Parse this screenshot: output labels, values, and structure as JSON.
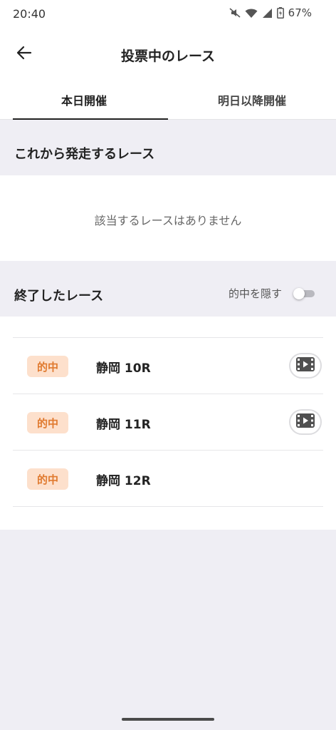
{
  "status_bar": {
    "time": "20:40",
    "battery": "67%",
    "icons": [
      "mute-icon",
      "wifi-icon",
      "signal-icon",
      "battery-icon"
    ]
  },
  "header": {
    "back_icon": "back-arrow-icon",
    "title": "投票中のレース"
  },
  "tabs": [
    {
      "label": "本日開催",
      "active": true
    },
    {
      "label": "明日以降開催",
      "active": false
    }
  ],
  "upcoming": {
    "title": "これから発走するレース",
    "empty_message": "該当するレースはありません"
  },
  "finished": {
    "title": "終了したレース",
    "hide_hits_label": "的中を隠す",
    "hide_hits_enabled": false,
    "races": [
      {
        "badge": "的中",
        "name": "静岡 10R",
        "has_video": true
      },
      {
        "badge": "的中",
        "name": "静岡 11R",
        "has_video": true
      },
      {
        "badge": "的中",
        "name": "静岡 12R",
        "has_video": false
      }
    ]
  },
  "colors": {
    "badge_bg": "#fde0cc",
    "badge_text": "#e07a2f",
    "page_bg": "#efeef4"
  }
}
